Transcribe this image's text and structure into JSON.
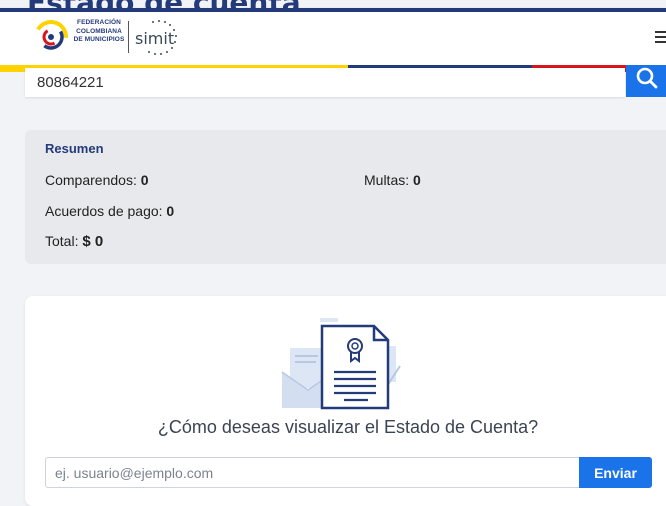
{
  "page": {
    "title": "Estado de cuenta"
  },
  "header": {
    "org_logo_text": [
      "FEDERACIÓN",
      "COLOMBIANA",
      "DE MUNICIPIOS"
    ],
    "product_logo_text": "simit",
    "menu_icon": "hamburger-menu-icon",
    "stripe_colors": [
      "#ffd200",
      "#243b7b",
      "#d8141c"
    ]
  },
  "search": {
    "value": "80864221",
    "icon": "search-icon"
  },
  "summary": {
    "title": "Resumen",
    "comparendos_label": "Comparendos:",
    "comparendos_value": "0",
    "multas_label": "Multas:",
    "multas_value": "0",
    "acuerdos_label": "Acuerdos de pago:",
    "acuerdos_value": "0",
    "total_label": "Total:",
    "total_value": "$ 0"
  },
  "options": {
    "illustration": "document-certificate-illustration",
    "question": "¿Cómo deseas visualizar el Estado de Cuenta?",
    "email_placeholder": "ej. usuario@ejemplo.com",
    "send_label": "Enviar"
  },
  "colors": {
    "primary": "#1a73e8",
    "brand": "#243b7b"
  }
}
